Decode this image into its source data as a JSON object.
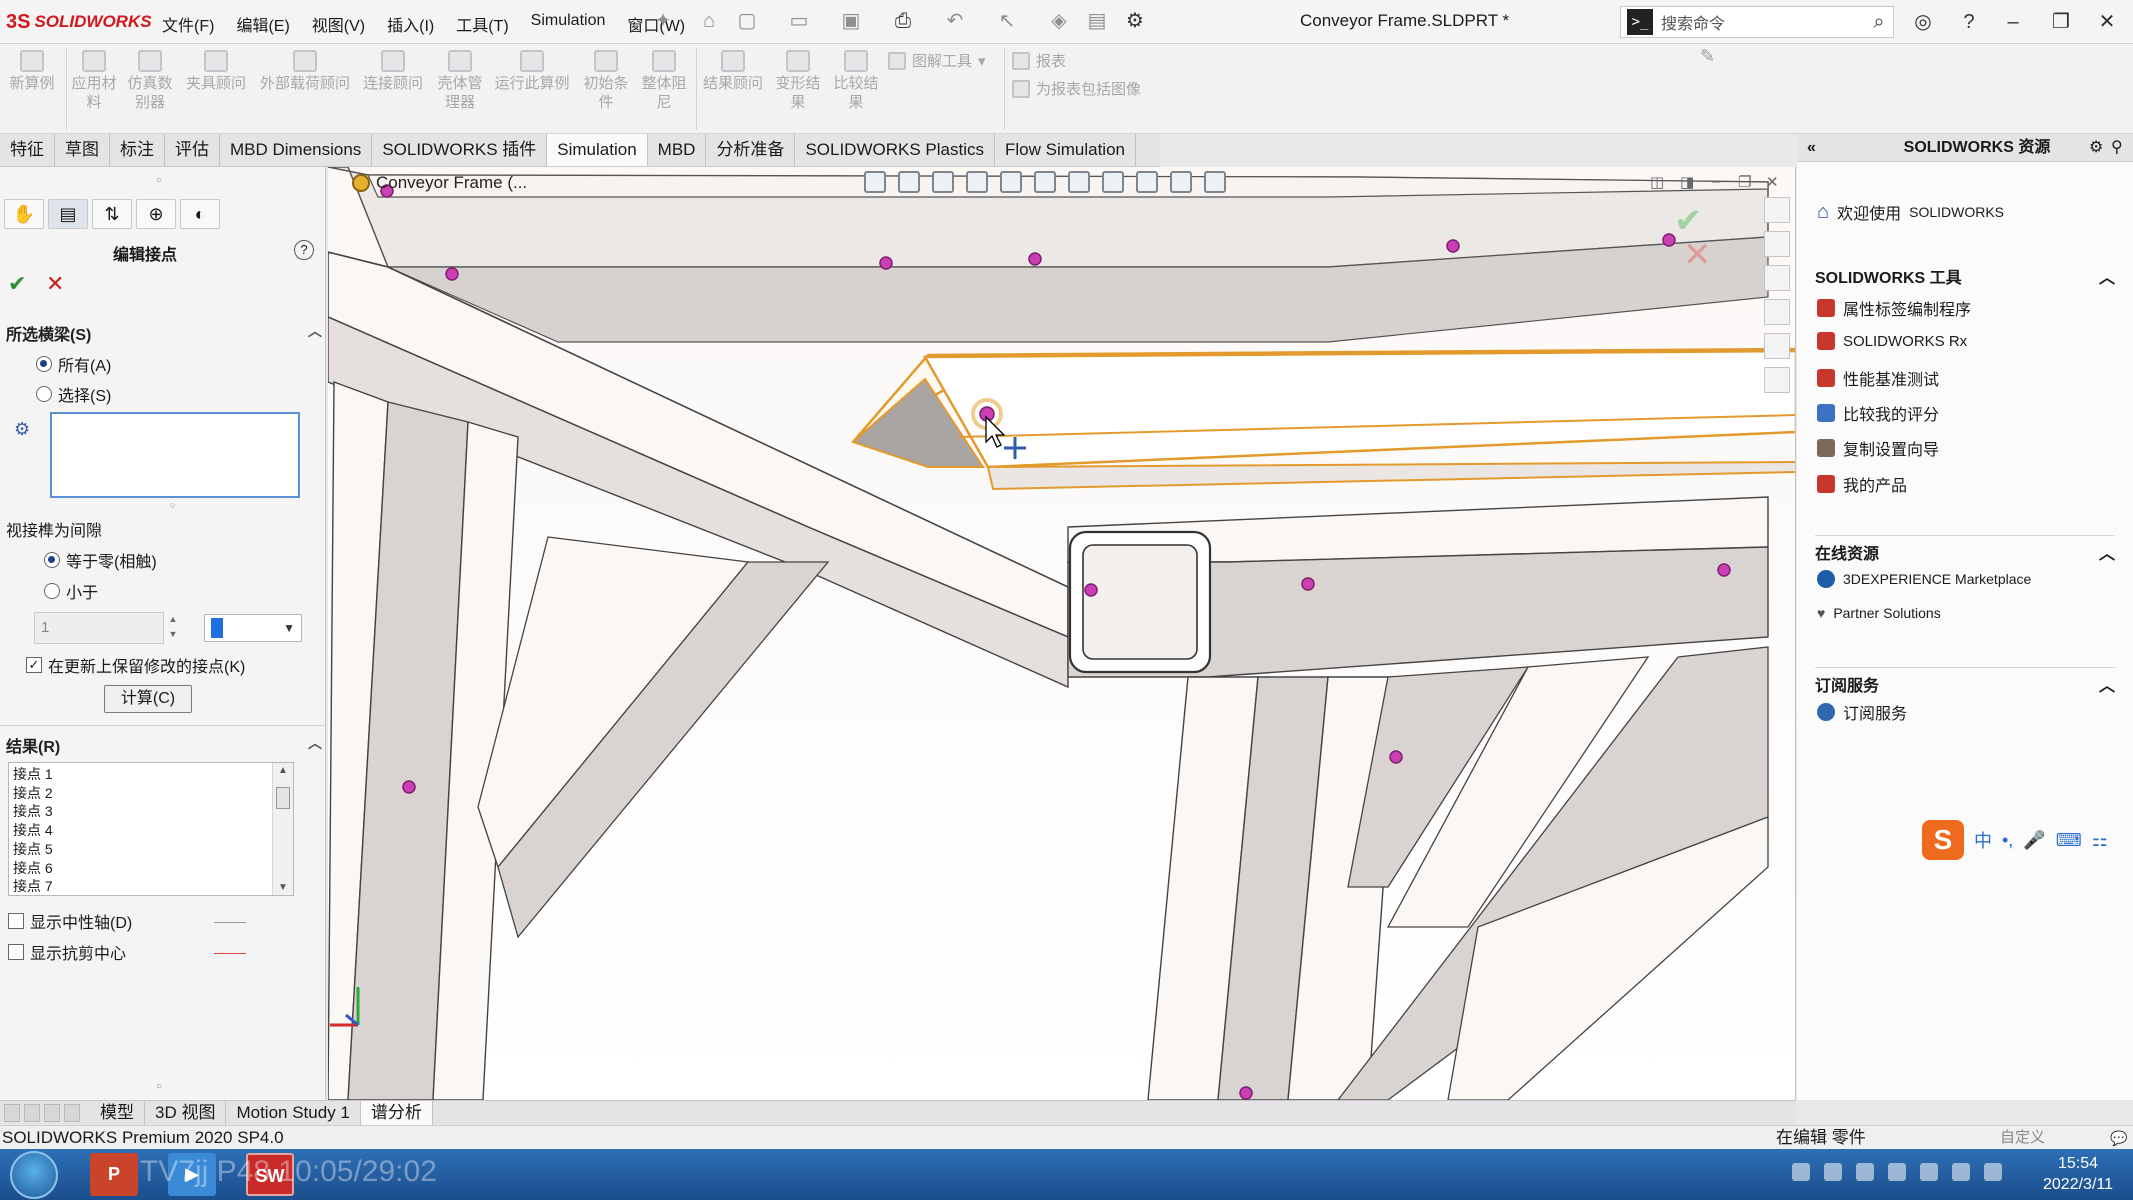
{
  "app": {
    "brand": "SOLIDWORKS",
    "brand_mark": "3S",
    "document_title": "Conveyor Frame.SLDPRT *"
  },
  "menus": [
    "文件(F)",
    "编辑(E)",
    "视图(V)",
    "插入(I)",
    "工具(T)",
    "Simulation",
    "窗口(W)"
  ],
  "search": {
    "placeholder": "搜索命令"
  },
  "command_manager": {
    "groups": [
      {
        "label": "新算例"
      },
      {
        "label": "应用材料"
      },
      {
        "label": "仿真数别器"
      },
      {
        "label": "夹具顾问"
      },
      {
        "label": "外部载荷顾问"
      },
      {
        "label": "连接顾问"
      },
      {
        "label": "壳体管理器"
      },
      {
        "label": "运行此算例"
      },
      {
        "label": "初始条件"
      },
      {
        "label": "整体阻尼"
      },
      {
        "label": "结果顾问"
      },
      {
        "label": "变形结果"
      },
      {
        "label": "比较结果"
      }
    ],
    "small": {
      "plot_tools": "图解工具",
      "report": "报表",
      "include_image": "为报表包括图像"
    }
  },
  "tabs": [
    {
      "label": "特征",
      "active": false
    },
    {
      "label": "草图",
      "active": false
    },
    {
      "label": "标注",
      "active": false
    },
    {
      "label": "评估",
      "active": false
    },
    {
      "label": "MBD Dimensions",
      "active": false
    },
    {
      "label": "SOLIDWORKS 插件",
      "active": false
    },
    {
      "label": "Simulation",
      "active": true
    },
    {
      "label": "MBD",
      "active": false
    },
    {
      "label": "分析准备",
      "active": false
    },
    {
      "label": "SOLIDWORKS Plastics",
      "active": false
    },
    {
      "label": "Flow Simulation",
      "active": false
    }
  ],
  "property_manager": {
    "title": "编辑接点",
    "selected_beams": {
      "header": "所选横梁(S)",
      "options": [
        {
          "label": "所有(A)",
          "checked": true
        },
        {
          "label": "选择(S)",
          "checked": false
        }
      ]
    },
    "gap": {
      "header": "视接榫为间隙",
      "options": [
        {
          "label": "等于零(相触)",
          "checked": true
        },
        {
          "label": "小于",
          "checked": false
        }
      ],
      "value": "1"
    },
    "keep_modified": {
      "label": "在更新上保留修改的接点(K)",
      "checked": true
    },
    "calculate": "计算(C)",
    "results": {
      "header": "结果(R)",
      "items": [
        "接点 1",
        "接点 2",
        "接点 3",
        "接点 4",
        "接点 5",
        "接点 6",
        "接点 7"
      ]
    },
    "show_neutral_axis": {
      "label": "显示中性轴(D)",
      "checked": false
    },
    "show_shear_center": {
      "label": "显示抗剪中心",
      "checked": false
    }
  },
  "viewport": {
    "model_title": "Conveyor Frame (..."
  },
  "bottom_tabs": [
    {
      "label": "模型",
      "active": false
    },
    {
      "label": "3D 视图",
      "active": false
    },
    {
      "label": "Motion Study 1",
      "active": false
    },
    {
      "label": "谱分析",
      "active": true
    }
  ],
  "status": {
    "product": "SOLIDWORKS Premium 2020 SP4.0",
    "mode": "在编辑 零件",
    "custom": "自定义"
  },
  "task_pane": {
    "title": "SOLIDWORKS 资源",
    "welcome": {
      "label": "欢迎使用",
      "brand": "SOLIDWORKS"
    },
    "sections": [
      {
        "title": "SOLIDWORKS 工具",
        "items": [
          "属性标签编制程序",
          "SOLIDWORKS Rx",
          "性能基准测试",
          "比较我的评分",
          "复制设置向导",
          "我的产品"
        ]
      },
      {
        "title": "在线资源",
        "items": [
          "3DEXPERIENCE Marketplace",
          "Partner Solutions"
        ]
      },
      {
        "title": "订阅服务",
        "items": [
          "订阅服务"
        ]
      }
    ]
  },
  "ime": {
    "logo": "S",
    "lang": "中",
    "punct": "•,"
  },
  "taskbar": {
    "time": "15:54",
    "date": "2022/3/11",
    "watermark": "TV7jj P48 10:05/29:02",
    "apps": [
      "P",
      "SW"
    ]
  },
  "colors": {
    "accent": "#1d3f8c",
    "brand": "#d3171d",
    "joint_marker": "#cc3fb4",
    "selection": "#e39a2d"
  }
}
